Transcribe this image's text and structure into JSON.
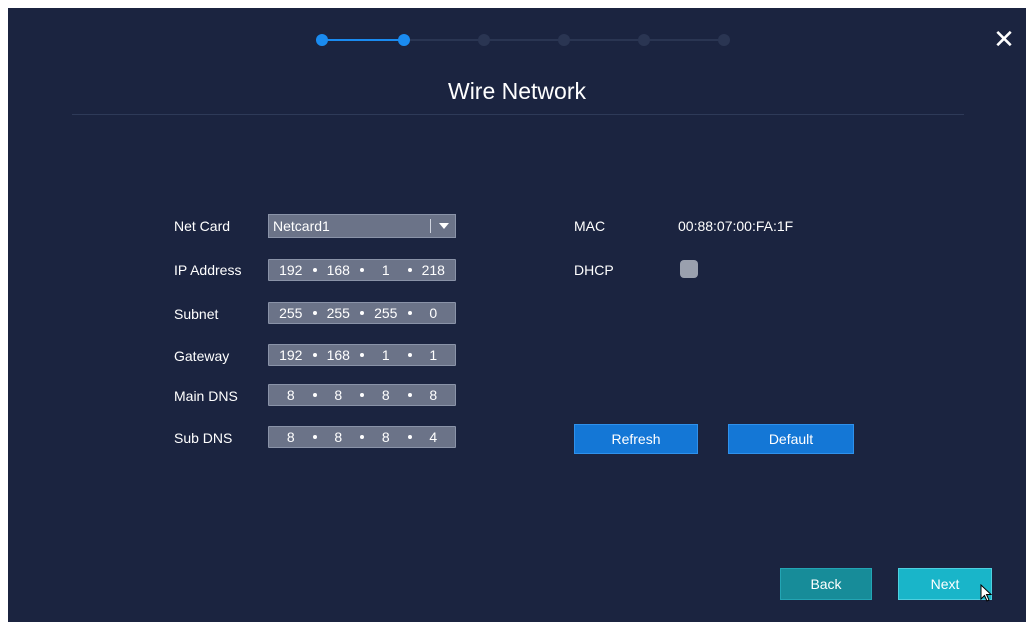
{
  "wizard": {
    "title": "Wire Network",
    "step_count": 6,
    "current_step": 2,
    "accent_color": "#1a8bf0"
  },
  "window": {
    "close_icon": "close-icon"
  },
  "form": {
    "net_card": {
      "label": "Net Card",
      "value": "Netcard1"
    },
    "ip_address": {
      "label": "IP Address",
      "octets": [
        "192",
        "168",
        "1",
        "218"
      ]
    },
    "subnet": {
      "label": "Subnet",
      "octets": [
        "255",
        "255",
        "255",
        "0"
      ]
    },
    "gateway": {
      "label": "Gateway",
      "octets": [
        "192",
        "168",
        "1",
        "1"
      ]
    },
    "main_dns": {
      "label": "Main DNS",
      "octets": [
        "8",
        "8",
        "8",
        "8"
      ]
    },
    "sub_dns": {
      "label": "Sub DNS",
      "octets": [
        "8",
        "8",
        "8",
        "4"
      ]
    },
    "mac": {
      "label": "MAC",
      "value": "00:88:07:00:FA:1F"
    },
    "dhcp": {
      "label": "DHCP",
      "checked": false
    }
  },
  "buttons": {
    "refresh": "Refresh",
    "default": "Default",
    "back": "Back",
    "next": "Next"
  },
  "colors": {
    "background": "#1b2440",
    "button_blue": "#1477d6",
    "button_teal": "#178c99",
    "button_next": "#19b5c9"
  }
}
